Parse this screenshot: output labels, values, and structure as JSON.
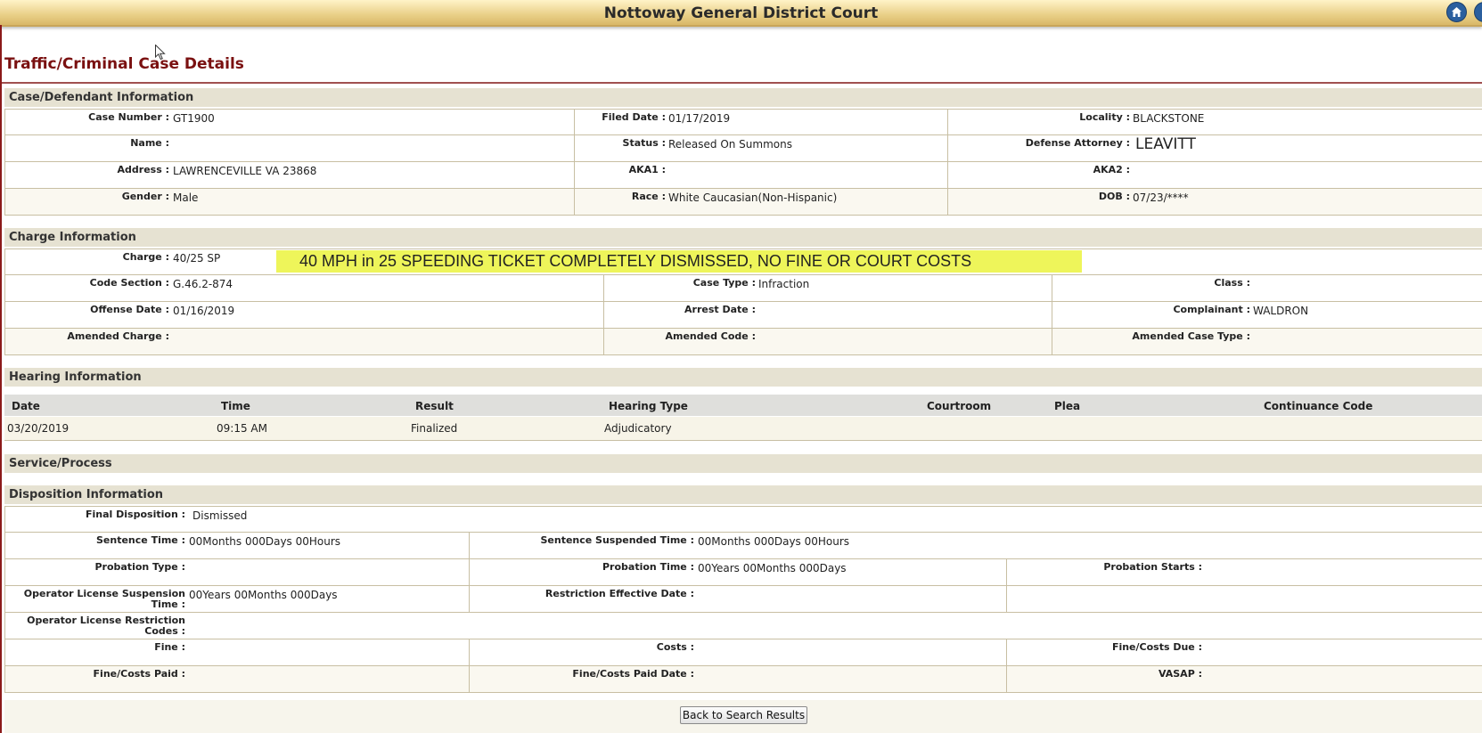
{
  "header": {
    "title": "Nottoway General District Court",
    "home_icon": "home-icon",
    "help_icon": "help-icon"
  },
  "page_title": "Traffic/Criminal Case Details",
  "case_info": {
    "heading": "Case/Defendant Information",
    "case_number_label": "Case Number :",
    "case_number": "GT1900",
    "filed_date_label": "Filed Date :",
    "filed_date": "01/17/2019",
    "locality_label": "Locality :",
    "locality": "BLACKSTONE",
    "name_label": "Name :",
    "name": "",
    "status_label": "Status :",
    "status": "Released On Summons",
    "attorney_label": "Defense Attorney :",
    "attorney": "LEAVITT",
    "address_label": "Address :",
    "address": "LAWRENCEVILLE VA 23868",
    "aka1_label": "AKA1 :",
    "aka1": "",
    "aka2_label": "AKA2 :",
    "aka2": "",
    "gender_label": "Gender :",
    "gender": "Male",
    "race_label": "Race :",
    "race": "White Caucasian(Non-Hispanic)",
    "dob_label": "DOB :",
    "dob": "07/23/****"
  },
  "charge_info": {
    "heading": "Charge Information",
    "charge_label": "Charge :",
    "charge": "40/25 SP",
    "banner": "40 MPH in 25 SPEEDING TICKET COMPLETELY DISMISSED, NO FINE OR COURT COSTS",
    "code_section_label": "Code Section :",
    "code_section": "G.46.2-874",
    "case_type_label": "Case Type :",
    "case_type": "Infraction",
    "class_label": "Class :",
    "class": "",
    "offense_date_label": "Offense Date :",
    "offense_date": "01/16/2019",
    "arrest_date_label": "Arrest Date :",
    "arrest_date": "",
    "complainant_label": "Complainant :",
    "complainant": "WALDRON",
    "amended_charge_label": "Amended Charge :",
    "amended_code_label": "Amended Code :",
    "amended_case_type_label": "Amended Case Type :"
  },
  "hearing_info": {
    "heading": "Hearing Information",
    "columns": [
      "Date",
      "Time",
      "Result",
      "Hearing Type",
      "Courtroom",
      "Plea",
      "Continuance Code"
    ],
    "rows": [
      [
        "03/20/2019",
        "09:15 AM",
        "Finalized",
        "Adjudicatory",
        "",
        "",
        ""
      ]
    ]
  },
  "service_process": {
    "heading": "Service/Process"
  },
  "disposition_info": {
    "heading": "Disposition Information",
    "final_disposition_label": "Final Disposition :",
    "final_disposition": "Dismissed",
    "sentence_time_label": "Sentence Time :",
    "sentence_time": "00Months 000Days 00Hours",
    "sentence_suspended_label": "Sentence Suspended Time :",
    "sentence_suspended": "00Months 000Days 00Hours",
    "probation_type_label": "Probation Type :",
    "probation_time_label": "Probation Time :",
    "probation_time": "00Years 00Months 000Days",
    "probation_starts_label": "Probation Starts :",
    "ol_suspension_label_1": "Operator License Suspension",
    "ol_suspension_label_2": "Time :",
    "ol_suspension": "00Years 00Months 000Days",
    "restriction_date_label": "Restriction Effective Date :",
    "ol_restriction_label_1": "Operator License Restriction",
    "ol_restriction_label_2": "Codes :",
    "fine_label": "Fine :",
    "costs_label": "Costs :",
    "fine_costs_due_label": "Fine/Costs Due :",
    "fine_costs_paid_label": "Fine/Costs Paid :",
    "fine_costs_paid_date_label": "Fine/Costs Paid Date :",
    "vasap_label": "VASAP :"
  },
  "back_button": "Back to Search Results"
}
